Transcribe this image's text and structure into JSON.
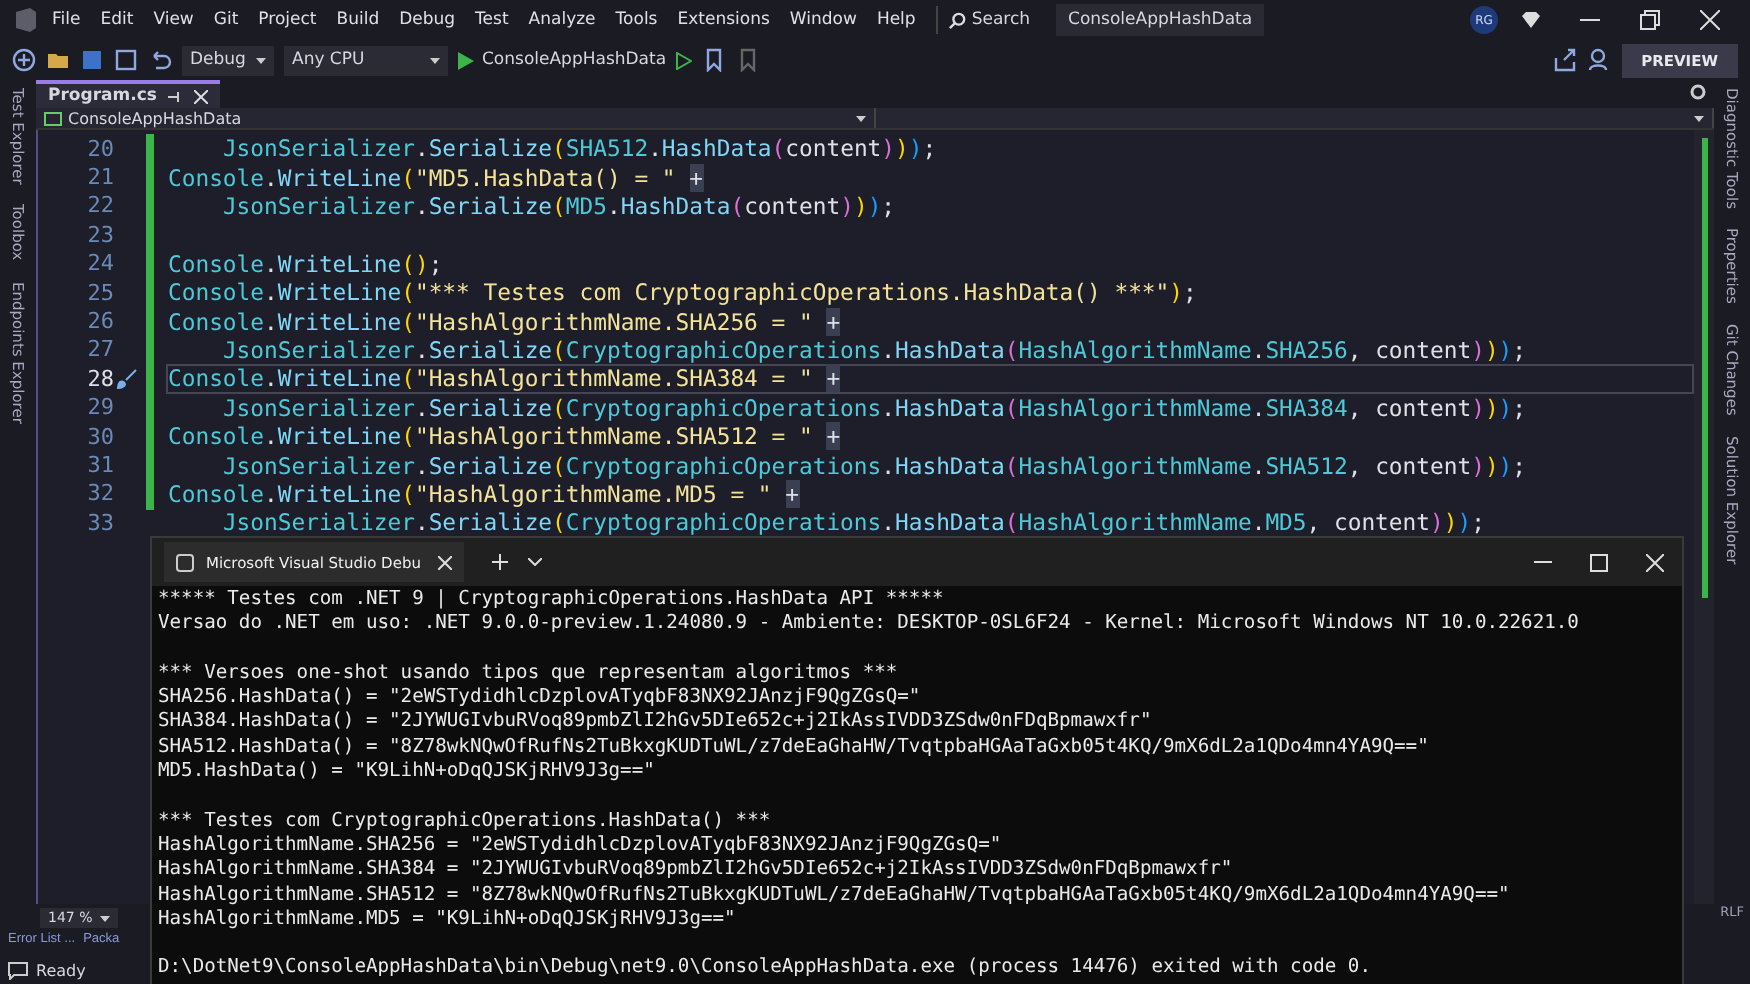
{
  "menu": [
    "File",
    "Edit",
    "View",
    "Git",
    "Project",
    "Build",
    "Debug",
    "Test",
    "Analyze",
    "Tools",
    "Extensions",
    "Window",
    "Help"
  ],
  "search": {
    "label": "Search"
  },
  "solution_name": "ConsoleAppHashData",
  "user_badge": "RG",
  "preview_button": "PREVIEW",
  "toolbar": {
    "configuration": "Debug",
    "platform": "Any CPU",
    "start_target": "ConsoleAppHashData"
  },
  "left_tool_tabs": [
    "Test Explorer",
    "Toolbox",
    "Endpoints Explorer"
  ],
  "right_tool_tabs": [
    "Diagnostic Tools",
    "Properties",
    "Git Changes",
    "Solution Explorer"
  ],
  "editor": {
    "tabs": [
      {
        "label": "Program.cs",
        "selected": true
      }
    ],
    "project_dropdown": "ConsoleAppHashData",
    "zoom": "147 %",
    "lines": [
      {
        "number": "20",
        "code": "    JsonSerializer.Serialize(SHA512.HashData(content)));",
        "current": false
      },
      {
        "number": "21",
        "code": "Console.WriteLine(\"MD5.HashData() = \" +",
        "current": false
      },
      {
        "number": "22",
        "code": "    JsonSerializer.Serialize(MD5.HashData(content)));",
        "current": false
      },
      {
        "number": "23",
        "current": false
      },
      {
        "number": "24",
        "code": "Console.WriteLine();",
        "current": false
      },
      {
        "number": "25",
        "code": "Console.WriteLine(\"*** Testes com CryptographicOperations.HashData() ***\");",
        "current": false
      },
      {
        "number": "26",
        "code": "Console.WriteLine(\"HashAlgorithmName.SHA256 = \" +",
        "current": false
      },
      {
        "number": "27",
        "code": "    JsonSerializer.Serialize(CryptographicOperations.HashData(HashAlgorithmName.SHA256, content)));",
        "current": false
      },
      {
        "number": "28",
        "code": "Console.WriteLine(\"HashAlgorithmName.SHA384 = \" +",
        "current": true
      },
      {
        "number": "29",
        "code": "    JsonSerializer.Serialize(CryptographicOperations.HashData(HashAlgorithmName.SHA384, content)));",
        "current": false
      },
      {
        "number": "30",
        "code": "Console.WriteLine(\"HashAlgorithmName.SHA512 = \" +",
        "current": false
      },
      {
        "number": "31",
        "code": "    JsonSerializer.Serialize(CryptographicOperations.HashData(HashAlgorithmName.SHA512, content)));",
        "current": false
      },
      {
        "number": "32",
        "code": "Console.WriteLine(\"HashAlgorithmName.MD5 = \" +",
        "current": false
      },
      {
        "number": "33",
        "code": "    JsonSerializer.Serialize(CryptographicOperations.HashData(HashAlgorithmName.MD5, content)));",
        "current": false
      }
    ]
  },
  "bottom_tabs": [
    "Error List ...",
    "Packa"
  ],
  "status_bar": {
    "text": "Ready",
    "line_ending": "RLF"
  },
  "console": {
    "title": "Microsoft Visual Studio Debu",
    "blocks": [
      [
        "***** Testes com .NET 9 | CryptographicOperations.HashData API *****",
        "Versao do .NET em uso: .NET 9.0.0-preview.1.24080.9 - Ambiente: DESKTOP-0SL6F24 - Kernel: Microsoft Windows NT 10.0.22621.0"
      ],
      [
        "*** Versoes one-shot usando tipos que representam algoritmos ***",
        "SHA256.HashData() = \"2eWSTydidhlcDzplovATyqbF83NX92JAnzjF9QgZGsQ=\"",
        "SHA384.HashData() = \"2JYWUGIvbuRVoq89pmbZlI2hGv5DIe652c+j2IkAssIVDD3ZSdw0nFDqBpmawxfr\"",
        "SHA512.HashData() = \"8Z78wkNQwOfRufNs2TuBkxgKUDTuWL/z7deEaGhaHW/TvqtpbaHGAaTaGxb05t4KQ/9mX6dL2a1QDo4mn4YA9Q==\"",
        "MD5.HashData() = \"K9LihN+oDqQJSKjRHV9J3g==\""
      ],
      [
        "*** Testes com CryptographicOperations.HashData() ***",
        "HashAlgorithmName.SHA256 = \"2eWSTydidhlcDzplovATyqbF83NX92JAnzjF9QgZGsQ=\"",
        "HashAlgorithmName.SHA384 = \"2JYWUGIvbuRVoq89pmbZlI2hGv5DIe652c+j2IkAssIVDD3ZSdw0nFDqBpmawxfr\"",
        "HashAlgorithmName.SHA512 = \"8Z78wkNQwOfRufNs2TuBkxgKUDTuWL/z7deEaGhaHW/TvqtpbaHGAaTaGxb05t4KQ/9mX6dL2a1QDo4mn4YA9Q==\"",
        "HashAlgorithmName.MD5 = \"K9LihN+oDqQJSKjRHV9J3g==\""
      ],
      [
        "D:\\DotNet9\\ConsoleAppHashData\\bin\\Debug\\net9.0\\ConsoleAppHashData.exe (process 14476) exited with code 0."
      ]
    ]
  }
}
